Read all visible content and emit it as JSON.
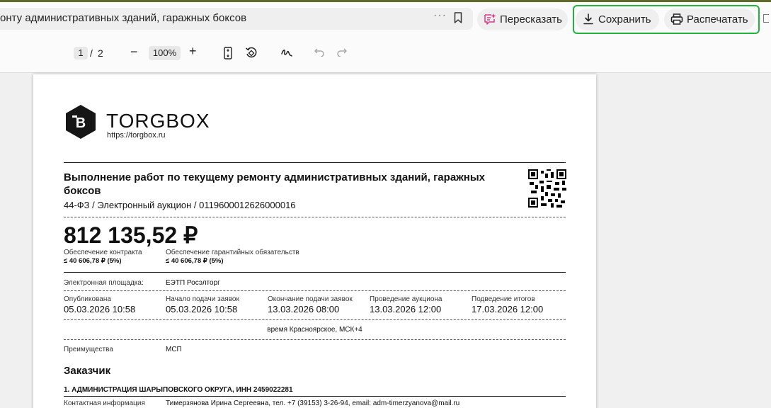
{
  "browser": {
    "url_title": "онту административных зданий, гаражных боксов",
    "dots": "···",
    "retell_label": "Пересказать",
    "save_label": "Сохранить",
    "print_label": "Распечатать"
  },
  "viewer": {
    "page_current": "1",
    "page_sep": "/",
    "page_total": "2",
    "zoom": "100%",
    "zoom_minus": "−",
    "zoom_plus": "+"
  },
  "doc": {
    "brand": "TORGBOX",
    "site": "https://torgbox.ru",
    "title": "Выполнение работ по текущему ремонту административных зданий, гаражных боксов",
    "subtitle": "44-ФЗ / Электронный аукцион / 0119600012626000016",
    "price": "812 135,52 ₽",
    "guarantees": [
      {
        "label": "Обеспечение контракта",
        "value": "≤ 40 606,78 ₽ (5%)"
      },
      {
        "label": "Обеспечение гарантийных обязательств",
        "value": "≤ 40 606,78 ₽ (5%)"
      }
    ],
    "platform_label": "Электронная площадка:",
    "platform_value": "ЕЭТП Росэлторг",
    "dates": [
      {
        "label": "Опубликована",
        "value": "05.03.2026 10:58"
      },
      {
        "label": "Начало подачи заявок",
        "value": "05.03.2026 10:58"
      },
      {
        "label": "Окончание подачи заявок",
        "value": "13.03.2026 08:00"
      },
      {
        "label": "Проведение аукциона",
        "value": "13.03.2026 12:00"
      },
      {
        "label": "Подведение итогов",
        "value": "17.03.2026 12:00"
      }
    ],
    "timezone": "время Красноярское, МСК+4",
    "advantages_label": "Преимущества",
    "advantages_value": "МСП",
    "customer_heading": "Заказчик",
    "customer_name": "1. АДМИНИСТРАЦИЯ ШАРЫПОВСКОГО ОКРУГА, ИНН 2459022281",
    "contact_label": "Контактная информация",
    "contact_value": "Тимерзянова Ирина Сергеевна, тел. +7 (39153) 3-26-94, email: adm-timerzyanova@mail.ru"
  },
  "colors": {
    "highlight": "#22b33e",
    "retell_icon": "#d63c86"
  }
}
